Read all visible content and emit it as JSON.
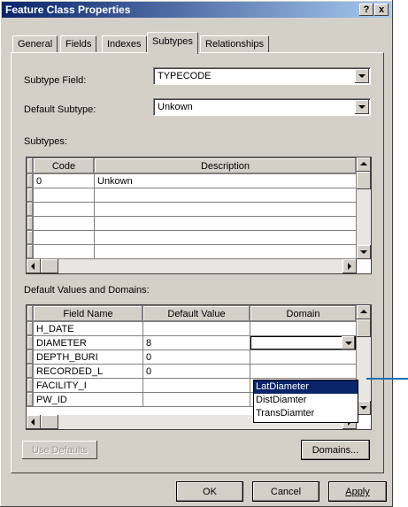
{
  "window": {
    "title": "Feature Class Properties",
    "help_btn": "?",
    "close_btn": "x"
  },
  "tabs": [
    {
      "label": "General"
    },
    {
      "label": "Fields"
    },
    {
      "label": "Indexes"
    },
    {
      "label": "Subtypes",
      "active": true
    },
    {
      "label": "Relationships"
    }
  ],
  "subtype_field": {
    "label": "Subtype Field:",
    "value": "TYPECODE"
  },
  "default_subtype": {
    "label": "Default Subtype:",
    "value": "Unkown"
  },
  "subtypes": {
    "label": "Subtypes:",
    "columns": [
      "Code",
      "Description"
    ],
    "rows": [
      [
        "0",
        "Unkown"
      ],
      [
        "",
        ""
      ],
      [
        "",
        ""
      ],
      [
        "",
        ""
      ],
      [
        "",
        ""
      ],
      [
        "",
        ""
      ]
    ]
  },
  "defaults": {
    "label": "Default Values and Domains:",
    "columns": [
      "Field Name",
      "Default Value",
      "Domain"
    ],
    "rows": [
      [
        "H_DATE",
        "",
        ""
      ],
      [
        "DIAMETER",
        "8",
        ""
      ],
      [
        "DEPTH_BURI",
        "0",
        ""
      ],
      [
        "RECORDED_L",
        "0",
        ""
      ],
      [
        "FACILITY_I",
        "",
        ""
      ],
      [
        "PW_ID",
        "",
        ""
      ]
    ]
  },
  "domain_options": [
    "LatDiameter",
    "DistDiamter",
    "TransDiamter"
  ],
  "domain_selected": "LatDiameter",
  "buttons": {
    "use_defaults": "Use Defaults",
    "domains": "Domains...",
    "ok": "OK",
    "cancel": "Cancel",
    "apply": "Apply"
  },
  "colors": {
    "title_bar": "#0a246a",
    "selection": "#0a246a",
    "callout": "#1a6fb0",
    "face": "#d4d0c8"
  }
}
